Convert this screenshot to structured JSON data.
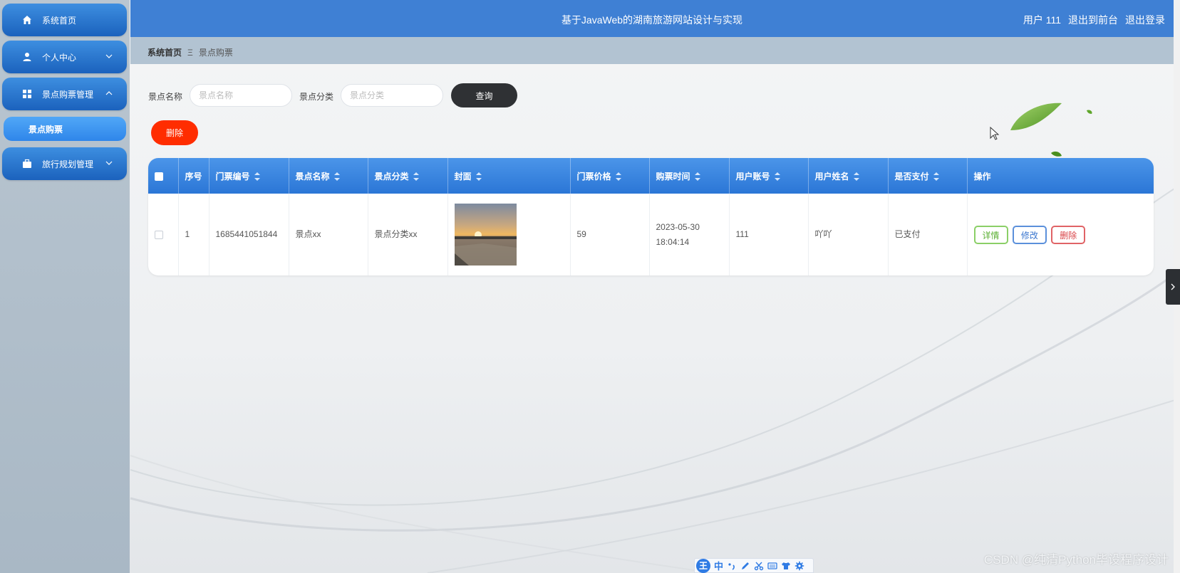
{
  "sidebar": {
    "items": [
      {
        "label": "系统首页",
        "icon": "home-icon"
      },
      {
        "label": "个人中心",
        "icon": "user-icon"
      },
      {
        "label": "景点购票管理",
        "icon": "grid-icon",
        "expanded": true,
        "children": [
          {
            "label": "景点购票",
            "active": true
          }
        ]
      },
      {
        "label": "旅行规划管理",
        "icon": "briefcase-icon"
      }
    ]
  },
  "header": {
    "title": "基于JavaWeb的湖南旅游网站设计与实现",
    "user": "用户 111",
    "to_front": "退出到前台",
    "logout": "退出登录"
  },
  "breadcrumb": {
    "home": "系统首页",
    "separator": "Ξ",
    "current": "景点购票"
  },
  "search": {
    "name_label": "景点名称",
    "name_placeholder": "景点名称",
    "category_label": "景点分类",
    "category_placeholder": "景点分类",
    "query_button": "查询"
  },
  "toolbar": {
    "delete_button": "删除"
  },
  "table": {
    "columns": [
      "序号",
      "门票编号",
      "景点名称",
      "景点分类",
      "封面",
      "门票价格",
      "购票时间",
      "用户账号",
      "用户姓名",
      "是否支付",
      "操作"
    ],
    "rows": [
      {
        "index": "1",
        "ticket_no": "1685441051844",
        "spot_name": "景点xx",
        "spot_category": "景点分类xx",
        "price": "59",
        "purchase_time": "2023-05-30 18:04:14",
        "account": "111",
        "user_name": "吖吖",
        "paid": "已支付",
        "actions": {
          "detail": "详情",
          "edit": "修改",
          "delete": "删除"
        }
      }
    ]
  },
  "ime": {
    "logo": "王",
    "mode": "中"
  },
  "watermark": "CSDN @纯清Python毕设程序设计",
  "colors": {
    "primary": "#3f80d4",
    "sidebar_button": "#1b62bd",
    "query_button": "#2f3134",
    "delete_button": "#ff2d00",
    "table_header": "#2b76d6"
  }
}
